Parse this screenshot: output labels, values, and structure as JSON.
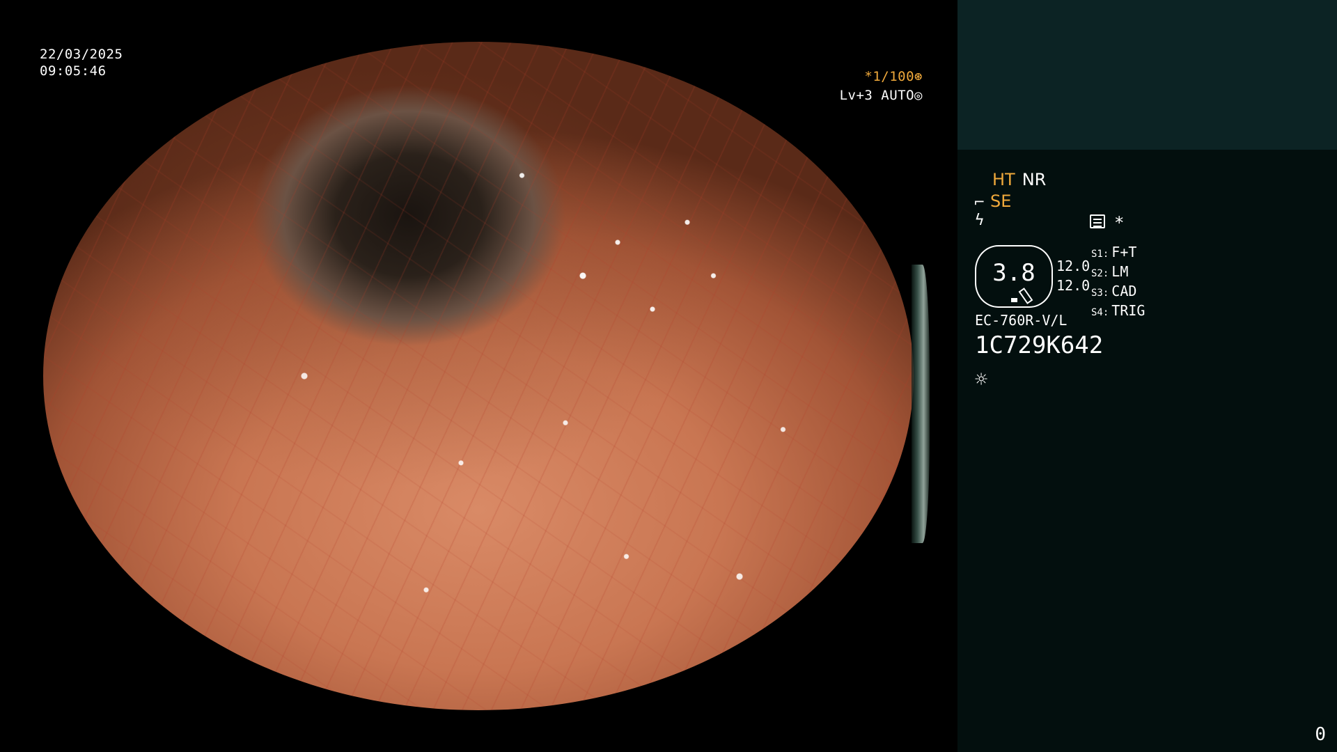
{
  "video": {
    "date": "22/03/2025",
    "time": "09:05:46",
    "shutter_speed": "*1/100",
    "shutter_icon": "aperture-icon",
    "exposure": "Lv+3 AUTO",
    "exposure_icon": "iris-icon"
  },
  "status_panel": {
    "enhancement": {
      "ht": "HT",
      "nr": "NR"
    },
    "se": {
      "icon": "scope-tip-icon",
      "label": "SE"
    },
    "flash_icon": "no-flash-icon",
    "menu_icon": "menu-list-icon",
    "asterisk": "*",
    "gauge": {
      "value": "3.8",
      "left_top": "12.0",
      "left_bottom": "12.0"
    },
    "switches": [
      {
        "key": "S1:",
        "value": "F+T"
      },
      {
        "key": "S2:",
        "value": "LM"
      },
      {
        "key": "S3:",
        "value": "CAD"
      },
      {
        "key": "S4:",
        "value": "TRIG"
      }
    ],
    "scope_model": "EC-760R-V/L",
    "scope_serial": "1C729K642",
    "light_icon": "sun-icon",
    "counter": "0"
  },
  "colors": {
    "accent_orange": "#f0a93b",
    "panel_bg": "#030f0e",
    "panel_top_bg": "#0c2324"
  }
}
